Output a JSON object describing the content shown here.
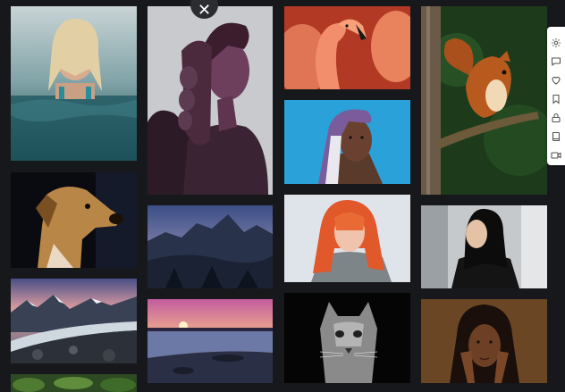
{
  "gallery": {
    "close_glyph": "✕",
    "tiles": [
      {
        "name": "woman-in-water-photo"
      },
      {
        "name": "dog-portrait-photo"
      },
      {
        "name": "mountain-glacier-photo"
      },
      {
        "name": "green-foliage-photo"
      },
      {
        "name": "woman-profile-braid-photo"
      },
      {
        "name": "mountain-dusk-photo"
      },
      {
        "name": "sunset-beach-photo"
      },
      {
        "name": "flamingo-photo"
      },
      {
        "name": "woman-headscarf-photo"
      },
      {
        "name": "red-hair-woman-photo"
      },
      {
        "name": "cat-portrait-photo"
      },
      {
        "name": "squirrel-on-branch-photo"
      },
      {
        "name": "woman-black-hair-photo"
      },
      {
        "name": "woman-hands-face-photo"
      }
    ]
  },
  "toolbar": {
    "tools": [
      "gear-icon",
      "comment-icon",
      "heart-icon",
      "bookmark-icon",
      "lock-icon",
      "book-icon",
      "video-icon"
    ]
  },
  "colors": {
    "background": "#17181b",
    "toolbar": "#ffffff",
    "icon": "#555555"
  }
}
